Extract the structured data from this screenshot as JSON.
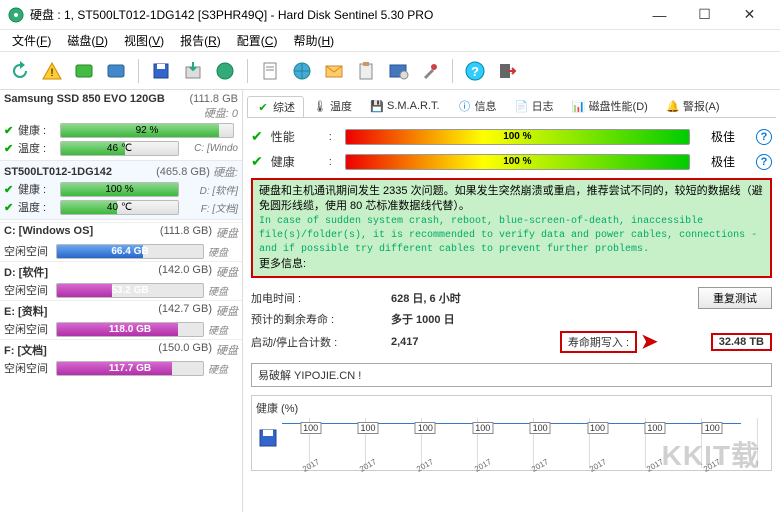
{
  "window": {
    "title": "硬盘 : 1, ST500LT012-1DG142 [S3PHR49Q]  -  Hard Disk Sentinel 5.30 PRO",
    "min": "—",
    "max": "☐",
    "close": "✕"
  },
  "menu": {
    "file": "文件",
    "disk": "磁盘",
    "view": "视图",
    "report": "报告",
    "config": "配置",
    "help": "帮助"
  },
  "tabs": {
    "overview": "综述",
    "temp": "温度",
    "smart": "S.M.A.R.T.",
    "info": "信息",
    "log": "日志",
    "perf": "磁盘性能(D)",
    "alert": "警报(A)"
  },
  "disks": [
    {
      "name": "Samsung SSD 850 EVO 120GB",
      "size": "(111.8 GB",
      "label": "硬盘: 0",
      "health_lbl": "健康 :",
      "health_val": "92 %",
      "health_pct": 92,
      "temp_lbl": "温度 :",
      "temp_val": "46 ℃",
      "temp_pct": 55,
      "drive": "C: [Windo"
    },
    {
      "name": "ST500LT012-1DG142",
      "size": "(465.8 GB)",
      "label": "硬盘:",
      "health_lbl": "健康 :",
      "health_val": "100 %",
      "health_pct": 100,
      "temp_lbl": "温度 :",
      "temp_val": "40 ℃",
      "temp_pct": 48,
      "drive_d": "D: [软件]",
      "drive_f": "F: [文档]"
    }
  ],
  "volumes": [
    {
      "name": "C: [Windows OS]",
      "size": "(111.8 GB)",
      "label": "硬盘",
      "free_lbl": "空闲空间",
      "free_val": "66.4 GB",
      "pct": 59,
      "color": "blue"
    },
    {
      "name": "D: [软件]",
      "size": "(142.0 GB)",
      "label": "硬盘",
      "free_lbl": "空闲空间",
      "free_val": "53.2 GB",
      "pct": 38,
      "color": "mag"
    },
    {
      "name": "E: [资料]",
      "size": "(142.7 GB)",
      "label": "硬盘",
      "free_lbl": "空闲空间",
      "free_val": "118.0 GB",
      "pct": 83,
      "color": "mag"
    },
    {
      "name": "F: [文档]",
      "size": "(150.0 GB)",
      "label": "硬盘",
      "free_lbl": "空闲空间",
      "free_val": "117.7 GB",
      "pct": 79,
      "color": "mag"
    }
  ],
  "meters": {
    "perf_lbl": "性能",
    "perf_val": "100 %",
    "perf_status": "极佳",
    "health_lbl": "健康",
    "health_val": "100 %",
    "health_status": "极佳",
    "help": "?"
  },
  "message": {
    "cn1": "硬盘和主机通讯期间发生 2335 次问题。如果发生突然崩溃或重启，推荐尝试不同的，较短的数据线（避免圆形线缆，使用 80 芯标准数据线代替）。",
    "en": "In case of sudden system crash, reboot, blue-screen-of-death, inaccessible file(s)/folder(s), it is recommended to verify data and power cables, connections - and if possible try different cables to prevent further problems.",
    "more": "更多信息:"
  },
  "info": {
    "uptime_lbl": "加电时间 :",
    "uptime_val": "628 日, 6 小时",
    "life_lbl": "预计的剩余寿命 :",
    "life_val": "多于 1000 日",
    "retest": "重复测试",
    "cycles_lbl": "启动/停止合计数 :",
    "cycles_val": "2,417",
    "write_lbl": "寿命期写入 :",
    "write_val": "32.48 TB"
  },
  "textfield": "易破解 YIPOJIE.CN !",
  "chart": {
    "title": "健康 (%)"
  },
  "chart_data": {
    "type": "line",
    "title": "健康 (%)",
    "ylabel": "%",
    "ylim": [
      0,
      100
    ],
    "categories": [
      "2017",
      "2017",
      "2017",
      "2017",
      "2017",
      "2017",
      "2017",
      "2017"
    ],
    "values": [
      100,
      100,
      100,
      100,
      100,
      100,
      100,
      100
    ]
  },
  "watermark": "KKIT载"
}
